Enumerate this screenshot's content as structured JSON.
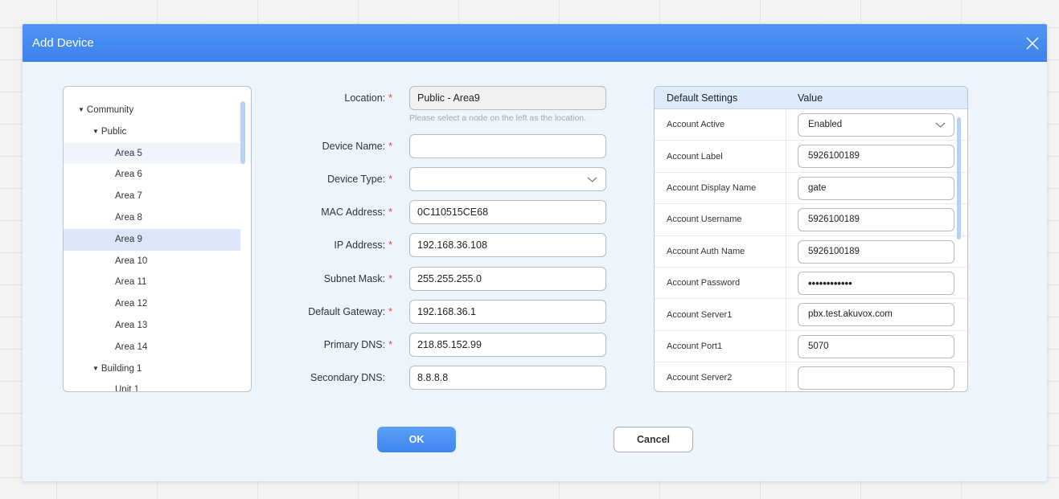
{
  "dialog": {
    "title": "Add Device"
  },
  "tree": {
    "items": [
      {
        "label": "Community",
        "level": 0,
        "expanded": true
      },
      {
        "label": "Public",
        "level": 1,
        "expanded": true
      },
      {
        "label": "Area 5",
        "level": 2
      },
      {
        "label": "Area 6",
        "level": 2
      },
      {
        "label": "Area 7",
        "level": 2
      },
      {
        "label": "Area 8",
        "level": 2
      },
      {
        "label": "Area 9",
        "level": 2,
        "selected": true
      },
      {
        "label": "Area 10",
        "level": 2
      },
      {
        "label": "Area 11",
        "level": 2
      },
      {
        "label": "Area 12",
        "level": 2
      },
      {
        "label": "Area 13",
        "level": 2
      },
      {
        "label": "Area 14",
        "level": 2
      },
      {
        "label": "Building 1",
        "level": 1,
        "expanded": true
      },
      {
        "label": "Unit 1",
        "level": 2
      }
    ]
  },
  "form": {
    "location": {
      "label": "Location:",
      "value": "Public - Area9",
      "hint": "Please select a node on the left as the location."
    },
    "device_name": {
      "label": "Device Name:",
      "value": ""
    },
    "device_type": {
      "label": "Device Type:",
      "value": ""
    },
    "mac_address": {
      "label": "MAC Address:",
      "value": "0C110515CE68"
    },
    "ip_address": {
      "label": "IP Address:",
      "value": "192.168.36.108"
    },
    "subnet_mask": {
      "label": "Subnet Mask:",
      "value": "255.255.255.0"
    },
    "default_gateway": {
      "label": "Default Gateway:",
      "value": "192.168.36.1"
    },
    "primary_dns": {
      "label": "Primary DNS:",
      "value": "218.85.152.99"
    },
    "secondary_dns": {
      "label": "Secondary DNS:",
      "value": "8.8.8.8"
    },
    "required_mark": "*"
  },
  "settings": {
    "header": {
      "col1": "Default Settings",
      "col2": "Value"
    },
    "rows": [
      {
        "name": "Account Active",
        "value": "Enabled"
      },
      {
        "name": "Account Label",
        "value": "5926100189"
      },
      {
        "name": "Account Display Name",
        "value": "gate"
      },
      {
        "name": "Account Username",
        "value": "5926100189"
      },
      {
        "name": "Account Auth Name",
        "value": "5926100189"
      },
      {
        "name": "Account Password",
        "value": "••••••••••••"
      },
      {
        "name": "Account Server1",
        "value": "pbx.test.akuvox.com"
      },
      {
        "name": "Account Port1",
        "value": "5070"
      },
      {
        "name": "Account Server2",
        "value": ""
      }
    ]
  },
  "footer": {
    "ok_label": "OK",
    "cancel_label": "Cancel"
  }
}
